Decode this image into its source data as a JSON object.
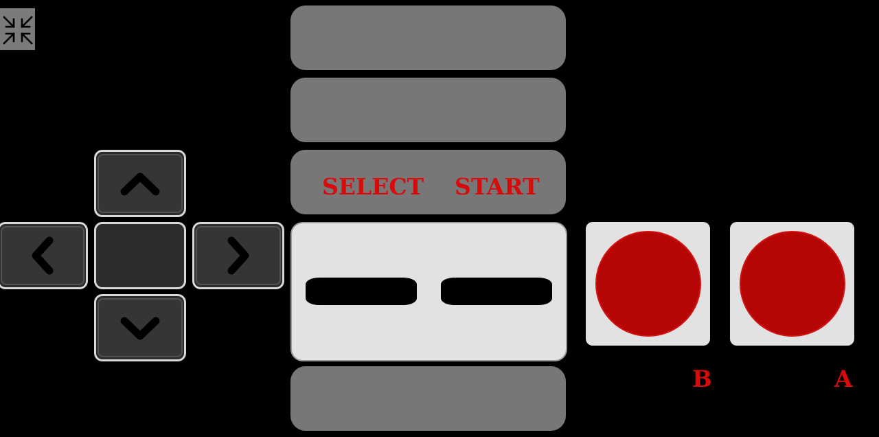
{
  "controls": {
    "exit_fullscreen_icon": "compress-arrows-icon",
    "select_label": "SELECT",
    "start_label": "START",
    "b_label": "B",
    "a_label": "A"
  },
  "colors": {
    "background": "#000000",
    "strip": "#777777",
    "panel": "#e2e2e2",
    "button_red": "#b50505",
    "label_red": "#d80a0a",
    "dpad": "#2d2d2d"
  }
}
